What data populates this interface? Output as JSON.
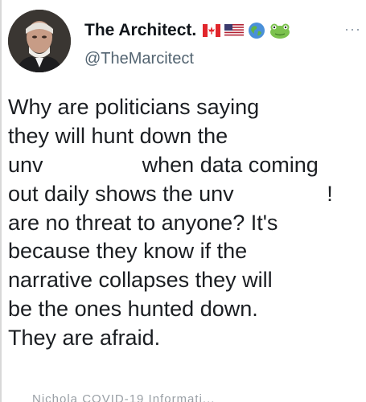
{
  "author": {
    "name": "The Architect.",
    "handle": "@TheMarcitect",
    "flag_icons": [
      "canada-flag-icon",
      "usa-flag-icon",
      "globe-icon",
      "frog-icon"
    ]
  },
  "menu": {
    "more_label": "···"
  },
  "tweet": {
    "lines": [
      "Why are politicians saying",
      "they will hunt down the",
      [
        "unv",
        "when data coming"
      ],
      [
        "out daily shows the unv",
        "!"
      ],
      "are no threat to anyone? It's",
      "because they know if the",
      "narrative collapses they will",
      "be the ones hunted down.",
      "They are afraid."
    ]
  },
  "footer": {
    "faded_text": "Nichola COVID-19 Informati..."
  },
  "colors": {
    "text": "#0f1419",
    "secondary": "#536471",
    "background": "#ffffff"
  }
}
